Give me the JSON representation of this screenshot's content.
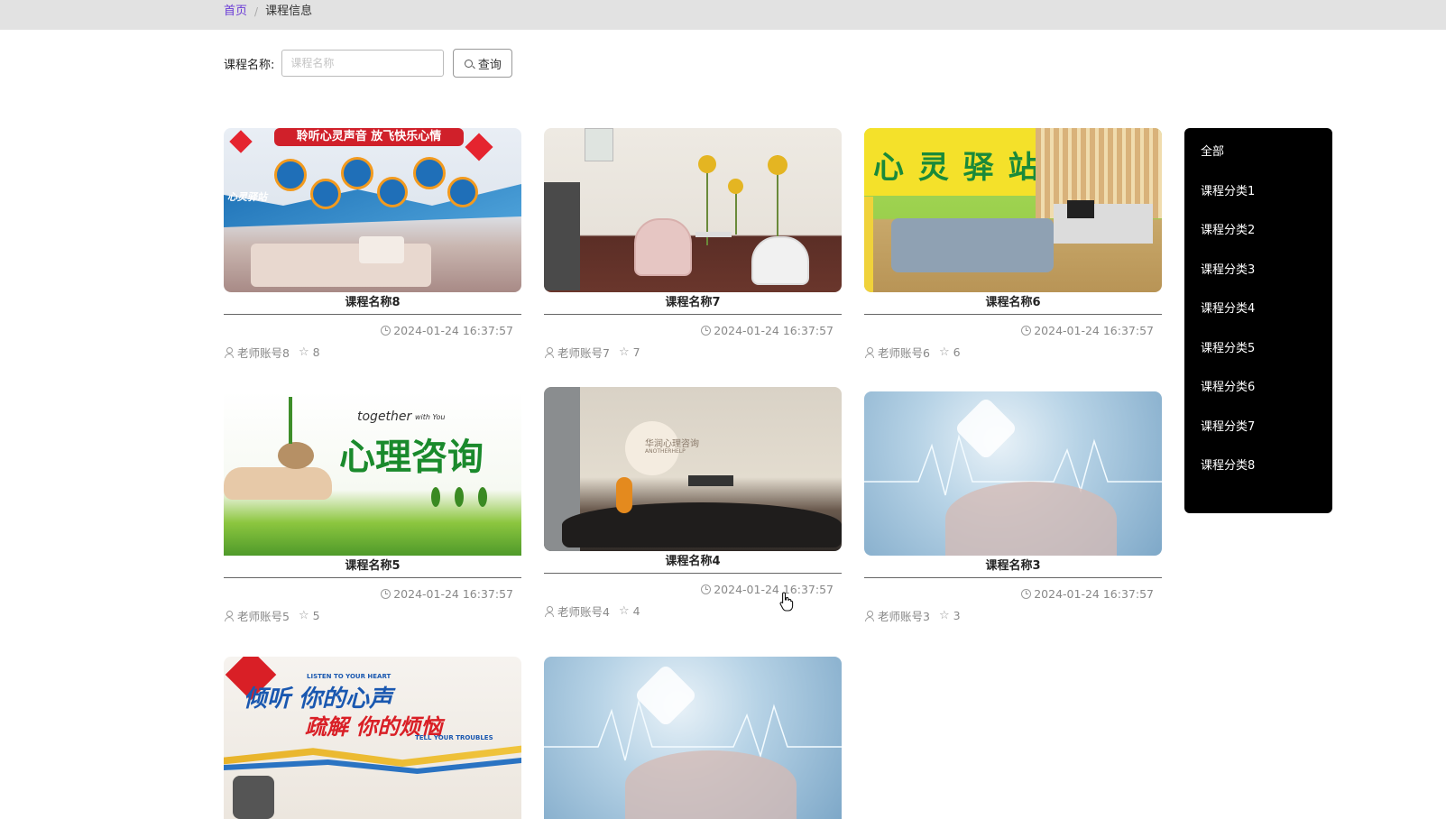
{
  "breadcrumb": {
    "home": "首页",
    "separator": "/",
    "current": "课程信息"
  },
  "search": {
    "label": "课程名称:",
    "placeholder": "课程名称",
    "value": "",
    "button_label": "查询"
  },
  "courses": [
    {
      "title": "课程名称8",
      "time": "2024-01-24 16:37:57",
      "teacher": "老师账号8",
      "stars": "8"
    },
    {
      "title": "课程名称7",
      "time": "2024-01-24 16:37:57",
      "teacher": "老师账号7",
      "stars": "7"
    },
    {
      "title": "课程名称6",
      "time": "2024-01-24 16:37:57",
      "teacher": "老师账号6",
      "stars": "6"
    },
    {
      "title": "课程名称5",
      "time": "2024-01-24 16:37:57",
      "teacher": "老师账号5",
      "stars": "5"
    },
    {
      "title": "课程名称4",
      "time": "2024-01-24 16:37:57",
      "teacher": "老师账号4",
      "stars": "4"
    },
    {
      "title": "课程名称3",
      "time": "2024-01-24 16:37:57",
      "teacher": "老师账号3",
      "stars": "3"
    }
  ],
  "image_text": {
    "c8_banner": "聆听心灵声音 放飞快乐心情",
    "c8_logo": "心灵驿站",
    "c6_sign": "心 灵 驿 站",
    "c5_en": "together",
    "c5_en_small": "with You",
    "c5_cn": "心理咨询",
    "c4_logo": "华润心理咨询",
    "c4_logo_en": "ANOTHERHELP",
    "c9_en": "LISTEN TO YOUR HEART",
    "c9_top": "倾听 你的心声",
    "c9_bottom": "疏解 你的烦恼",
    "c9_en2": "TELL YOUR TROUBLES"
  },
  "sidebar": {
    "items": [
      "全部",
      "课程分类1",
      "课程分类2",
      "课程分类3",
      "课程分类4",
      "课程分类5",
      "课程分类6",
      "课程分类7",
      "课程分类8"
    ]
  },
  "colors": {
    "accent": "#6a3bd6",
    "sidebar_bg": "#000000",
    "topbar_bg": "#e2e2e2"
  },
  "icons": {
    "search": "search-icon",
    "clock": "clock-icon",
    "user": "user-icon",
    "star": "star-icon"
  }
}
